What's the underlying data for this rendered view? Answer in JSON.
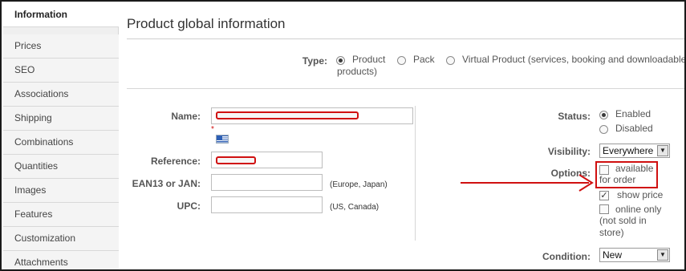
{
  "sidebar": {
    "items": [
      {
        "label": "Information",
        "active": true
      },
      {
        "label": "Prices"
      },
      {
        "label": "SEO"
      },
      {
        "label": "Associations"
      },
      {
        "label": "Shipping"
      },
      {
        "label": "Combinations"
      },
      {
        "label": "Quantities"
      },
      {
        "label": "Images"
      },
      {
        "label": "Features"
      },
      {
        "label": "Customization"
      },
      {
        "label": "Attachments"
      }
    ]
  },
  "panel": {
    "title": "Product global information",
    "type_label": "Type:",
    "type_options": [
      {
        "label": "Product",
        "label2": "products)",
        "checked": true
      },
      {
        "label": "Pack",
        "checked": false
      },
      {
        "label": "Virtual Product (services, booking and downloadable",
        "checked": false
      }
    ],
    "name_label": "Name:",
    "reference_label": "Reference:",
    "ean_label": "EAN13 or JAN:",
    "ean_hint": "(Europe, Japan)",
    "upc_label": "UPC:",
    "upc_hint": "(US, Canada)",
    "required_mark": "*",
    "status_label": "Status:",
    "status_options": [
      {
        "label": "Enabled",
        "checked": true
      },
      {
        "label": "Disabled",
        "checked": false
      }
    ],
    "visibility_label": "Visibility:",
    "visibility_value": "Everywhere",
    "options_label": "Options:",
    "options": [
      {
        "label_line1": "available",
        "label_line2": "for order",
        "checked": false
      },
      {
        "label_line1": "show price",
        "checked": true
      },
      {
        "label_line1": "online only",
        "label_line2": "(not sold in",
        "label_line3": "store)",
        "checked": false
      }
    ],
    "condition_label": "Condition:",
    "condition_value": "New"
  },
  "annotation_color": "#d01010",
  "icons": {
    "flag": "language-flag-icon",
    "dropdown": "chevron-down-icon",
    "checkmark": "checkmark-icon",
    "arrow": "annotation-arrow-icon"
  }
}
